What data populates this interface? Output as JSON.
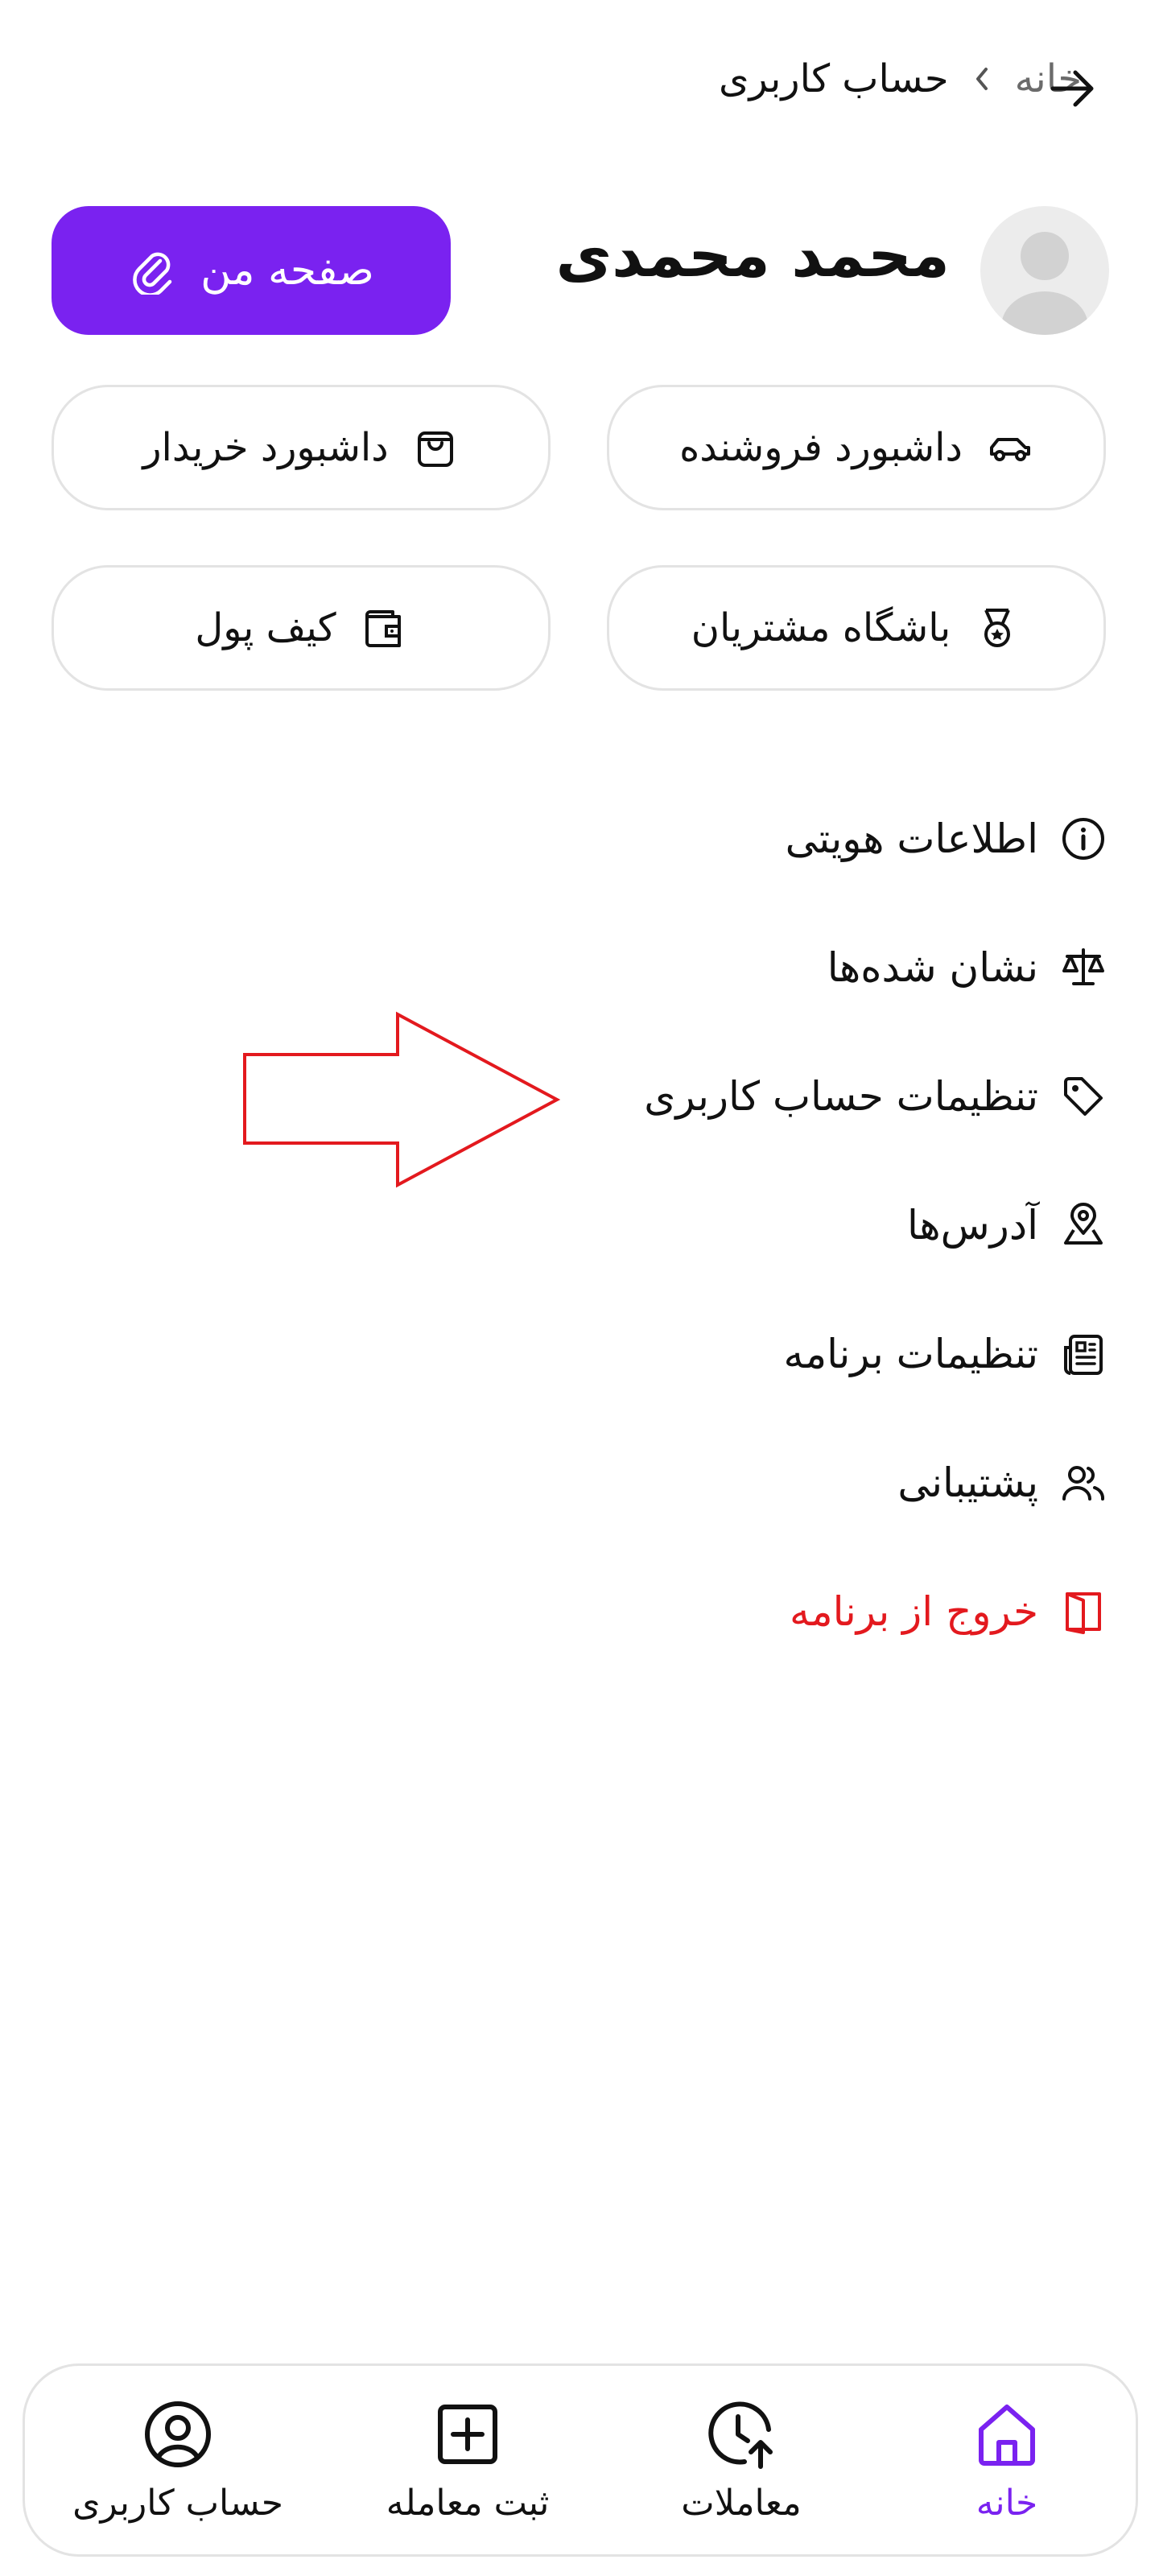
{
  "header": {
    "breadcrumb": {
      "home": "خانه",
      "current": "حساب کاربری"
    }
  },
  "profile": {
    "name": "محمد محمدی",
    "my_page_label": "صفحه من"
  },
  "tiles": [
    {
      "label": "داشبورد فروشنده",
      "icon": "car-icon"
    },
    {
      "label": "داشبورد خریدار",
      "icon": "shopping-bag-icon"
    },
    {
      "label": "باشگاه مشتریان",
      "icon": "medal-icon"
    },
    {
      "label": "کیف پول",
      "icon": "wallet-icon"
    }
  ],
  "menu": [
    {
      "label": "اطلاعات هویتی",
      "icon": "info-icon"
    },
    {
      "label": "نشان شده‌ها",
      "icon": "scale-icon"
    },
    {
      "label": "تنظیمات حساب کاربری",
      "icon": "tag-icon"
    },
    {
      "label": "آدرس‌ها",
      "icon": "location-icon"
    },
    {
      "label": "تنظیمات برنامه",
      "icon": "document-icon"
    },
    {
      "label": "پشتیبانی",
      "icon": "users-icon"
    },
    {
      "label": "خروج از برنامه",
      "icon": "logout-door-icon"
    }
  ],
  "bottom_nav": [
    {
      "label": "خانه",
      "icon": "home-icon",
      "active": true
    },
    {
      "label": "معاملات",
      "icon": "clock-arrow-icon",
      "active": false
    },
    {
      "label": "ثبت معامله",
      "icon": "plus-square-icon",
      "active": false
    },
    {
      "label": "حساب کاربری",
      "icon": "user-circle-icon",
      "active": false
    }
  ],
  "colors": {
    "accent": "#7a22f0",
    "danger": "#e3191e",
    "annotation": "#e3191e",
    "border": "#e3e3e3"
  }
}
